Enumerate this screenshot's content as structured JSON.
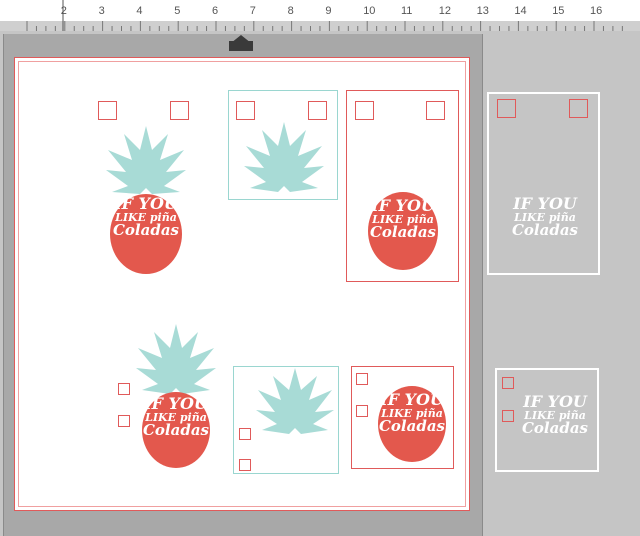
{
  "ruler": {
    "ticks": [
      "2",
      "3",
      "4",
      "5",
      "6",
      "7",
      "8",
      "9",
      "10",
      "11",
      "12",
      "13",
      "14",
      "15",
      "16"
    ]
  },
  "design": {
    "line1": "IF YOU",
    "line2": "LIKE piña",
    "line3": "Coladas"
  },
  "colors": {
    "teal": "#a8dbd6",
    "coral": "#e3584d",
    "mat": "#a8a8a8",
    "canvas": "#c5c5c5"
  },
  "icons": {
    "feed_arrow": "up-arrow-icon"
  }
}
